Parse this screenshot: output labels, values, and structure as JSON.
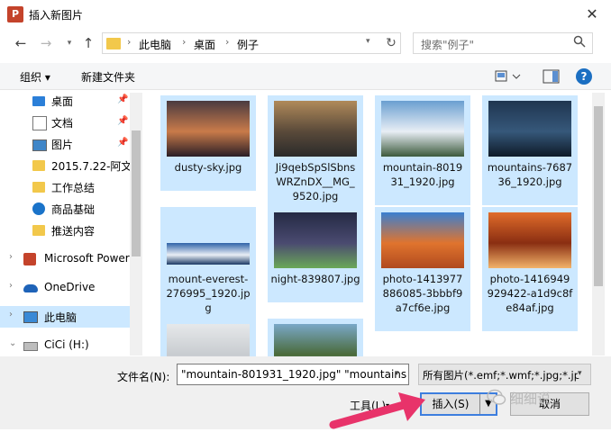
{
  "window": {
    "title": "插入新图片",
    "app_icon": "P",
    "close": "✕"
  },
  "nav": {
    "back": "←",
    "forward": "→",
    "up": "↑",
    "breadcrumb": [
      "此电脑",
      "桌面",
      "例子"
    ],
    "refresh": "↻",
    "search_placeholder": "搜索\"例子\""
  },
  "toolbar": {
    "organize": "组织 ▾",
    "new_folder": "新建文件夹",
    "help": "?"
  },
  "sidebar": [
    {
      "label": "桌面",
      "icon": "desktop-icon",
      "pinned": true
    },
    {
      "label": "文档",
      "icon": "document-icon",
      "pinned": true
    },
    {
      "label": "图片",
      "icon": "picture-icon",
      "pinned": true
    },
    {
      "label": "2015.7.22-阿文-",
      "icon": "folder-icon",
      "pinned": false
    },
    {
      "label": "工作总结",
      "icon": "folder-icon",
      "pinned": false
    },
    {
      "label": "商品基础",
      "icon": "globe-icon",
      "pinned": false
    },
    {
      "label": "推送内容",
      "icon": "folder-icon",
      "pinned": false
    },
    {
      "label": "Microsoft Power",
      "icon": "powerpoint-icon",
      "pinned": false
    },
    {
      "label": "OneDrive",
      "icon": "cloud-icon",
      "pinned": false
    },
    {
      "label": "此电脑",
      "icon": "computer-icon",
      "pinned": false
    },
    {
      "label": "CiCi (H:)",
      "icon": "drive-icon",
      "pinned": false
    }
  ],
  "files": [
    {
      "name": "dusty-sky.jpg",
      "colors": [
        "#4a3a40",
        "#c97b4a",
        "#2a1e26"
      ]
    },
    {
      "name": "Ji9qebSpSlSbns\nWRZnDX__MG_\n9520.jpg",
      "colors": [
        "#b08a5a",
        "#5a4a3a",
        "#2a2a2a"
      ]
    },
    {
      "name": "mountain-8019\n31_1920.jpg",
      "colors": [
        "#6a9fd0",
        "#e8eef5",
        "#3c5a3c"
      ]
    },
    {
      "name": "mountains-7687\n36_1920.jpg",
      "colors": [
        "#1f3550",
        "#36587a",
        "#0e1a28"
      ]
    },
    {
      "name": "mount-everest-\n276995_1920.jp\ng",
      "colors": [
        "#2f63a8",
        "#e9eef5",
        "#1b3a66"
      ]
    },
    {
      "name": "night-839807.jpg",
      "colors": [
        "#242a44",
        "#4a4a70",
        "#6aa858"
      ]
    },
    {
      "name": "photo-1413977\n886085-3bbbf9\na7cf6e.jpg",
      "colors": [
        "#3a7fd0",
        "#e0742e",
        "#b04a1e"
      ]
    },
    {
      "name": "photo-1416949\n929422-a1d9c8f\ne84af.jpg",
      "colors": [
        "#e06c2a",
        "#8a2e12",
        "#f2b36a"
      ]
    },
    {
      "name": "",
      "colors": [
        "#e6e8ea",
        "#c8ccd0",
        "#f4f5f6"
      ]
    },
    {
      "name": "",
      "colors": [
        "#7aa8c8",
        "#4a6a3a",
        "#c8d8e0"
      ]
    }
  ],
  "bottom": {
    "filename_label": "文件名(N):",
    "filename_value": "\"mountain-801931_1920.jpg\" \"mountains",
    "filetype_value": "所有图片(*.emf;*.wmf;*.jpg;*.jp",
    "tools": "工具(L)",
    "insert": "插入(S)",
    "cancel": "取消"
  },
  "watermark": "细细说",
  "accent": "#3d7ede",
  "selection_color": "#cce8ff",
  "annotation_arrow_color": "#e8336a"
}
